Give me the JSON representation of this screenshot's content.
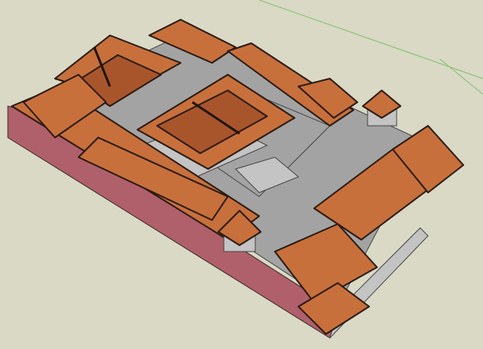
{
  "viewport": {
    "background_color": "#d9d9c6",
    "axis_color": "#7fbf6a",
    "roof_color": "#c8703c",
    "wall_color": "#b0606a",
    "floor_color": "#a3a3a3"
  }
}
